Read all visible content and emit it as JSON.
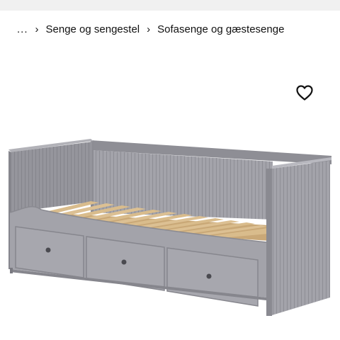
{
  "breadcrumb": {
    "ellipsis": "...",
    "separator": "›",
    "items": [
      {
        "label": "Senge og sengestel"
      },
      {
        "label": "Sofasenge og gæstesenge"
      }
    ]
  },
  "favorite": {
    "icon": "heart-outline-icon"
  },
  "product": {
    "image": "grey-daybed-with-three-drawers"
  },
  "colors": {
    "frame": "#9c9ca3",
    "frame_dark": "#7d7d84",
    "slats": "#d8b989",
    "topbar": "#f0f0f0"
  }
}
